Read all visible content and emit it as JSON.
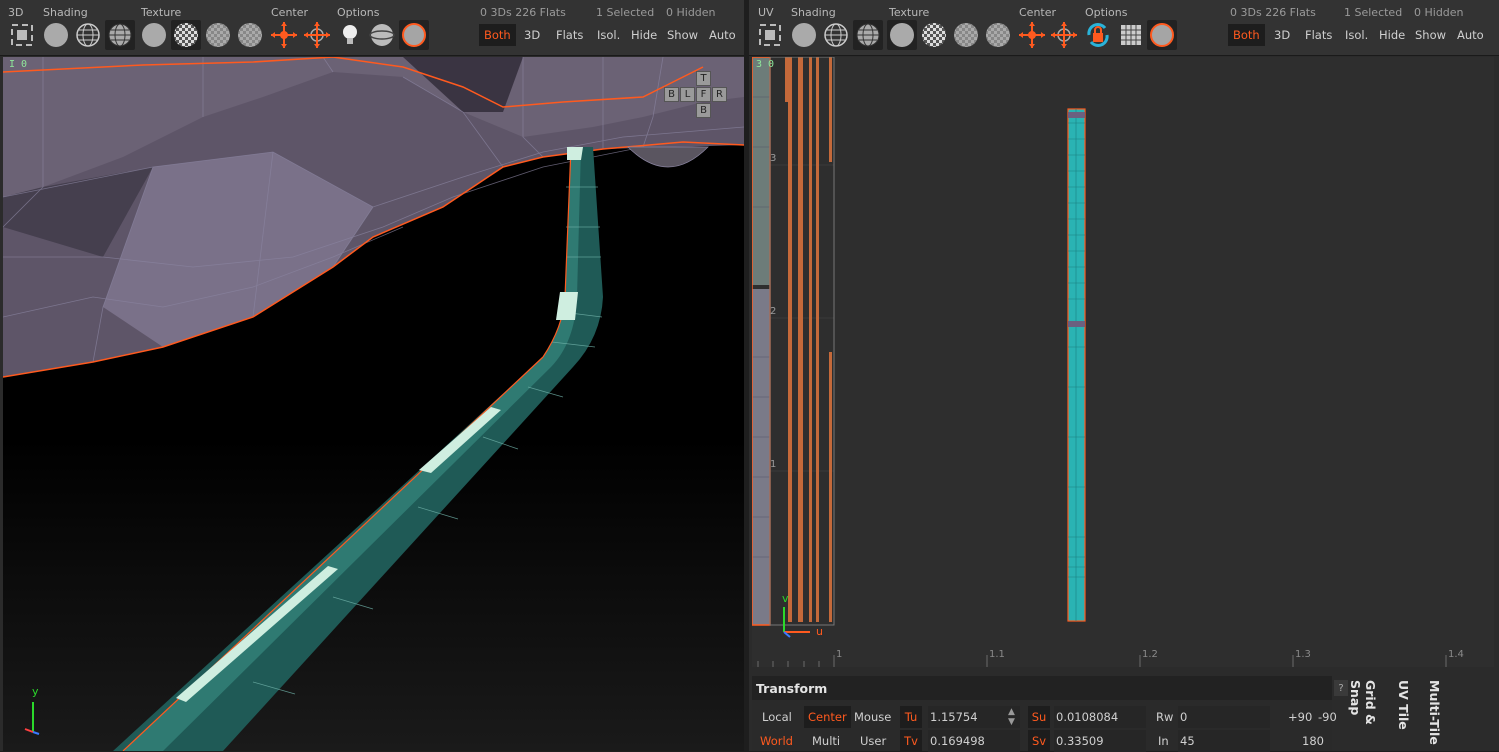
{
  "left_panel": {
    "labels": {
      "mode": "3D",
      "shading": "Shading",
      "texture": "Texture",
      "center": "Center",
      "options": "Options"
    },
    "stats": {
      "count": "0 3Ds 226 Flats",
      "selected": "1 Selected",
      "hidden": "0 Hidden"
    },
    "buttons": {
      "both": "Both",
      "three_d": "3D",
      "flats": "Flats",
      "isol": "Isol.",
      "hide": "Hide",
      "show": "Show",
      "auto": "Auto"
    },
    "axis_readout": "I 0",
    "view_cube": {
      "top": "T",
      "left": "L",
      "front": "F",
      "right": "R",
      "back": "B",
      "bottom": "B"
    },
    "axis_y": "y"
  },
  "right_panel": {
    "labels": {
      "mode": "UV",
      "shading": "Shading",
      "texture": "Texture",
      "center": "Center",
      "options": "Options"
    },
    "stats": {
      "count": "0 3Ds 226 Flats",
      "selected": "1 Selected",
      "hidden": "0 Hidden"
    },
    "buttons": {
      "both": "Both",
      "three_d": "3D",
      "flats": "Flats",
      "isol": "Isol.",
      "hide": "Hide",
      "show": "Show",
      "auto": "Auto"
    },
    "uv_readout": "3 0",
    "v_ticks": [
      "3",
      "2",
      "1"
    ],
    "u_ticks": [
      "1",
      "1.1",
      "1.2",
      "1.3",
      "1.4"
    ],
    "axis_v": "v",
    "axis_u": "u"
  },
  "transform": {
    "title": "Transform",
    "help": "?",
    "local": "Local",
    "center": "Center",
    "mouse": "Mouse",
    "world": "World",
    "multi": "Multi",
    "user": "User",
    "tu_label": "Tu",
    "tu_value": "1.15754",
    "tv_label": "Tv",
    "tv_value": "0.169498",
    "su_label": "Su",
    "su_value": "0.0108084",
    "sv_label": "Sv",
    "sv_value": "0.33509",
    "rw_label": "Rw",
    "rw_value": "0",
    "in_label": "In",
    "in_value": "45",
    "rot_plus90": "+90",
    "rot_minus90": "-90",
    "rot_180": "180"
  },
  "side_tabs": {
    "grid_snap": "Grid & Snap",
    "uv_tile": "UV Tile",
    "multi_tile": "Multi-Tile"
  },
  "colors": {
    "accent": "#ff5a1f",
    "pipe": "#1f5a56",
    "hull": "#5e5568",
    "uv_strip": "#2ab3b3"
  },
  "icons": [
    "frame-icon",
    "sphere-solid-icon",
    "sphere-wire-icon",
    "sphere-wire-solid-icon",
    "sphere-flat-icon",
    "checker-icon",
    "checker-dim-icon",
    "center-cross-icon",
    "center-target-icon",
    "lightbulb-icon",
    "ring-icon",
    "material-ball-icon",
    "lock-rotate-icon",
    "grid-icon"
  ]
}
